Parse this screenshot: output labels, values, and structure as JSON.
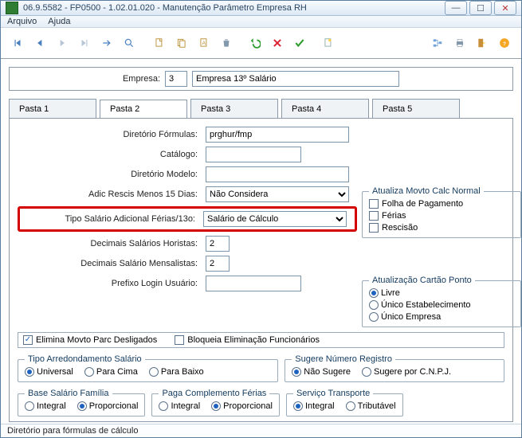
{
  "window": {
    "title": "06.9.5582 - FP0500 - 1.02.01.020 - Manutenção Parâmetro Empresa RH"
  },
  "menu": {
    "arquivo": "Arquivo",
    "ajuda": "Ajuda"
  },
  "empresa": {
    "label": "Empresa:",
    "code": "3",
    "name": "Empresa 13º Salário"
  },
  "tabs": {
    "t1": "Pasta 1",
    "t2": "Pasta 2",
    "t3": "Pasta 3",
    "t4": "Pasta 4",
    "t5": "Pasta 5"
  },
  "form": {
    "diretorio_formulas": {
      "label": "Diretório Fórmulas:",
      "value": "prghur/fmp"
    },
    "catalogo": {
      "label": "Catálogo:",
      "value": ""
    },
    "diretorio_modelo": {
      "label": "Diretório Modelo:",
      "value": ""
    },
    "adic_rescis": {
      "label": "Adic Rescis Menos 15 Dias:",
      "value": "Não Considera"
    },
    "tipo_salario": {
      "label": "Tipo Salário Adicional Férias/13o:",
      "value": "Salário de Cálculo"
    },
    "dec_horistas": {
      "label": "Decimais Salários Horistas:",
      "value": "2"
    },
    "dec_mensalistas": {
      "label": "Decimais Salário Mensalistas:",
      "value": "2"
    },
    "prefixo_login": {
      "label": "Prefixo Login Usuário:",
      "value": ""
    },
    "elimina_movto": "Elimina Movto Parc Desligados",
    "bloqueia_elim": "Bloqueia Eliminação Funcionários"
  },
  "atualiza_movto": {
    "legend": "Atualiza Movto Calc Normal",
    "folha": "Folha de Pagamento",
    "ferias": "Férias",
    "rescisao": "Rescisão"
  },
  "atualiza_cartao": {
    "legend": "Atualização Cartão Ponto",
    "livre": "Livre",
    "unico_estab": "Único Estabelecimento",
    "unico_emp": "Único Empresa"
  },
  "tipo_arred": {
    "legend": "Tipo Arredondamento Salário",
    "universal": "Universal",
    "para_cima": "Para Cima",
    "para_baixo": "Para Baixo"
  },
  "sugere_num": {
    "legend": "Sugere Número Registro",
    "nao_sugere": "Não Sugere",
    "cnpj": "Sugere por C.N.P.J."
  },
  "base_familia": {
    "legend": "Base Salário Família",
    "integral": "Integral",
    "proporcional": "Proporcional"
  },
  "paga_comp": {
    "legend": "Paga Complemento Férias",
    "integral": "Integral",
    "proporcional": "Proporcional"
  },
  "servico_transp": {
    "legend": "Serviço Transporte",
    "integral": "Integral",
    "tributavel": "Tributável"
  },
  "status": "Diretório para fórmulas de cálculo"
}
